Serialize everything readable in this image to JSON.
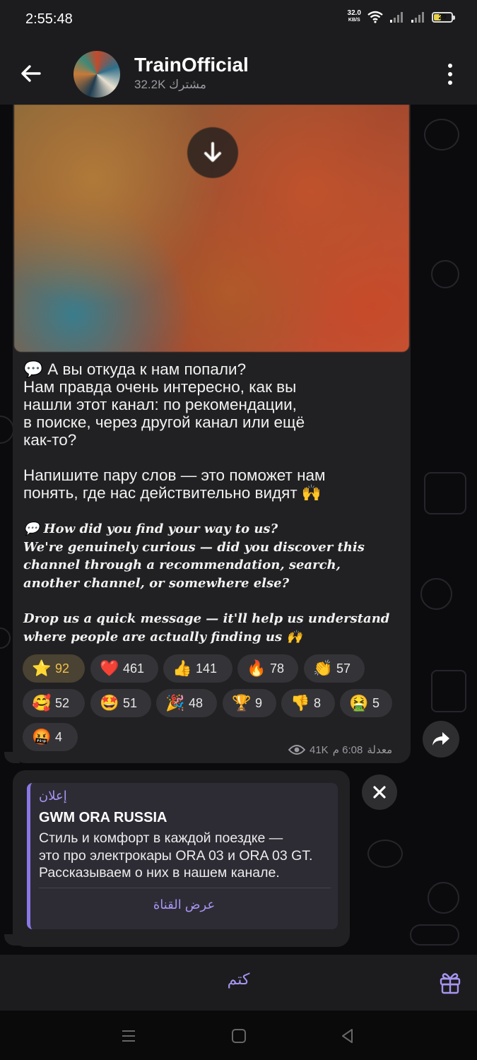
{
  "status_bar": {
    "time": "2:55:48",
    "net_speed": "32.0",
    "net_unit": "KB/S",
    "battery": "29"
  },
  "header": {
    "channel_name": "TrainOfficial",
    "subscribers": "32.2K مشترك",
    "icons": [
      "back-arrow-icon",
      "more-vert-icon"
    ]
  },
  "message": {
    "ru_paragraph_1": [
      "💬 А вы откуда к нам попали?",
      "Нам правда очень интересно, как вы",
      "нашли этот канал: по рекомендации,",
      "в поиске, через другой канал или ещё",
      "как-то?"
    ],
    "ru_paragraph_2": [
      "Напишите пару слов — это поможет нам",
      "понять, где нас действительно видят 🙌"
    ],
    "en_paragraph_1": [
      "💬 How did you find your way to us?",
      "We're genuinely curious — did you discover this",
      "channel through a recommendation, search,",
      "another channel, or somewhere else?"
    ],
    "en_paragraph_2": [
      "Drop us a quick message — it'll help us understand",
      "where people are actually finding us 🙌"
    ],
    "reactions": [
      {
        "emoji": "⭐",
        "count": "92",
        "active": true
      },
      {
        "emoji": "❤️",
        "count": "461"
      },
      {
        "emoji": "👍",
        "count": "141"
      },
      {
        "emoji": "🔥",
        "count": "78"
      },
      {
        "emoji": "👏",
        "count": "57"
      },
      {
        "emoji": "🥰",
        "count": "52"
      },
      {
        "emoji": "🤩",
        "count": "51"
      },
      {
        "emoji": "🎉",
        "count": "48"
      },
      {
        "emoji": "🏆",
        "count": "9"
      },
      {
        "emoji": "👎",
        "count": "8"
      },
      {
        "emoji": "🤮",
        "count": "5"
      },
      {
        "emoji": "🤬",
        "count": "4"
      }
    ],
    "views": "41K",
    "time": "6:08 م",
    "edited": "معدلة"
  },
  "ad": {
    "label": "إعلان",
    "title": "GWM ORA RUSSIA",
    "body": [
      "Стиль и комфорт в каждой поездке —",
      "это про электрокары ORA 03 и ORA 03 GT.",
      "Рассказываем о них в нашем канале."
    ],
    "action": "عرض القناة"
  },
  "bottom": {
    "mute_label": "كتم"
  },
  "colors": {
    "accent": "#a895f2",
    "bubble": "#212123",
    "header": "#1c1c1e",
    "star_reaction": "#f0c04a"
  }
}
